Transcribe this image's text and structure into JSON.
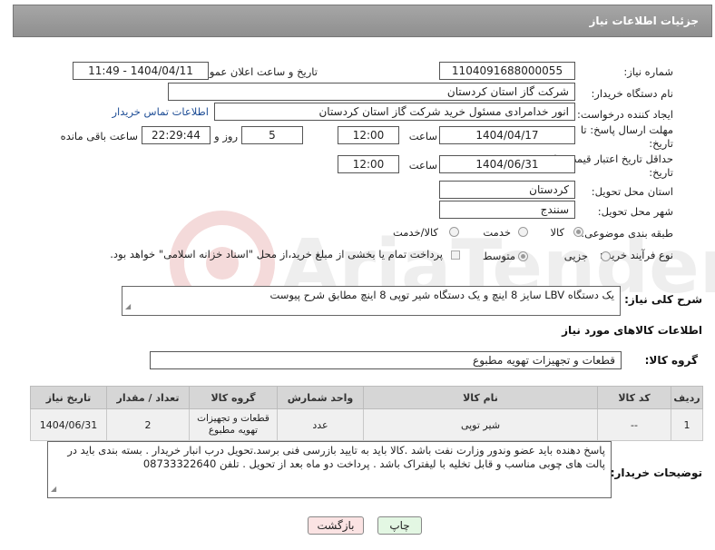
{
  "header": {
    "title": "جزئیات اطلاعات نیاز"
  },
  "fields": {
    "need_number_label": "شماره نیاز:",
    "need_number": "1104091688000055",
    "announce_label": "تاریخ و ساعت اعلان عمومی:",
    "announce_value": "1404/04/11 - 11:49",
    "buyer_org_label": "نام دستگاه خریدار:",
    "buyer_org": "شرکت گاز استان کردستان",
    "creator_label": "ایجاد کننده درخواست:",
    "creator": "انور خدامرادی مسئول خرید  شرکت گاز استان کردستان",
    "contact_link": "اطلاعات تماس خریدار",
    "deadline_label": "مهلت ارسال پاسخ: تا تاریخ:",
    "deadline_date": "1404/04/17",
    "time_label": "ساعت",
    "deadline_time": "12:00",
    "days": "5",
    "days_label": "روز و",
    "remaining_time": "22:29:44",
    "remaining_label": "ساعت باقی مانده",
    "min_price_label": "حداقل تاریخ اعتبار قیمت: تا تاریخ:",
    "price_date": "1404/06/31",
    "price_time": "12:00",
    "province_label": "استان محل تحویل:",
    "province": "کردستان",
    "city_label": "شهر محل تحویل:",
    "city": "سنندج",
    "category_label": "طبقه بندی موضوعی:",
    "category_options": [
      "کالا",
      "خدمت",
      "کالا/خدمت"
    ],
    "process_label": "نوع فرآیند خرید :",
    "process_options": [
      "جزیی",
      "متوسط"
    ],
    "payment_note": "پرداخت تمام یا بخشی از مبلغ خرید،از محل \"اسناد خزانه اسلامی\" خواهد بود."
  },
  "summary": {
    "label": "شرح کلی نیاز:",
    "text": "یک دستگاه LBV  سایز 8  اینچ  و یک دستگاه شیر توپی 8 اینچ مطابق شرح پیوست"
  },
  "goods": {
    "section_title": "اطلاعات کالاهای مورد نیاز",
    "group_label": "گروه کالا:",
    "group_value": "قطعات و تجهیزات تهویه مطبوع",
    "columns": [
      "ردیف",
      "کد کالا",
      "نام کالا",
      "واحد شمارش",
      "گروه کالا",
      "تعداد / مقدار",
      "تاریخ نیاز"
    ],
    "rows": [
      [
        "1",
        "--",
        "شیر توپی",
        "عدد",
        "قطعات و تجهیزات تهویه مطبوع",
        "2",
        "1404/06/31"
      ]
    ]
  },
  "buyer_notes": {
    "label": "توضیحات خریدار:",
    "text": "پاسخ دهنده باید عضو وندور وزارت نفت باشد .کالا باید به تایید بازرسی فنی  برسد.تحویل درب انبار خریدار . بسته بندی باید در پالت های چوبی مناسب و قابل تخلیه با لیفتراک باشد . پرداخت دو ماه بعد از تحویل . تلفن 08733322640"
  },
  "buttons": {
    "print": "چاپ",
    "back": "بازگشت"
  },
  "colors": {
    "header_bg": "#9b9b9b",
    "link": "#1f4e96",
    "print_bg": "#e3f7e3",
    "back_bg": "#fbe3e3"
  }
}
